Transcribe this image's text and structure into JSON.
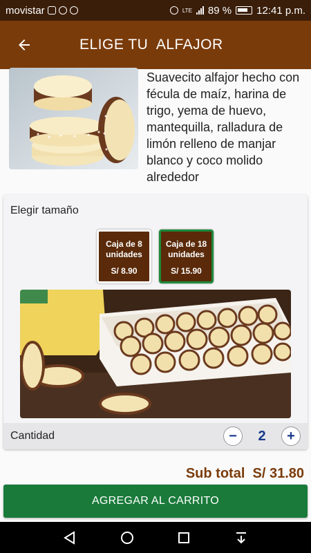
{
  "status_bar": {
    "carrier": "movistar",
    "network": "LTE",
    "battery": "89 %",
    "time": "12:41 p.m."
  },
  "app_bar": {
    "title": "ELIGE TU  ALFAJOR"
  },
  "product": {
    "description": "Suavecito alfajor hecho con fécula de maíz, harina de trigo, yema de huevo, mantequilla, ralladura de limón relleno de manjar blanco y coco molido alrededor"
  },
  "size_selector": {
    "label": "Elegir tamaño",
    "options": [
      {
        "name": "Caja de 8 unidades",
        "price": "S/ 8.90",
        "selected": false
      },
      {
        "name": "Caja de 18 unidades",
        "price": "S/ 15.90",
        "selected": true
      }
    ]
  },
  "quantity": {
    "label": "Cantidad",
    "value": "2",
    "minus": "−",
    "plus": "+"
  },
  "subtotal": {
    "text": "Sub total  S/ 31.80"
  },
  "cta": {
    "label": "AGREGAR AL CARRITO"
  },
  "colors": {
    "app_bar": "#7a3b0a",
    "status_bar": "#3a1e0a",
    "cta": "#197a3a",
    "size_button": "#5a2a0a",
    "selected_border": "#1c8a3a",
    "quantity_accent": "#183a8a"
  }
}
